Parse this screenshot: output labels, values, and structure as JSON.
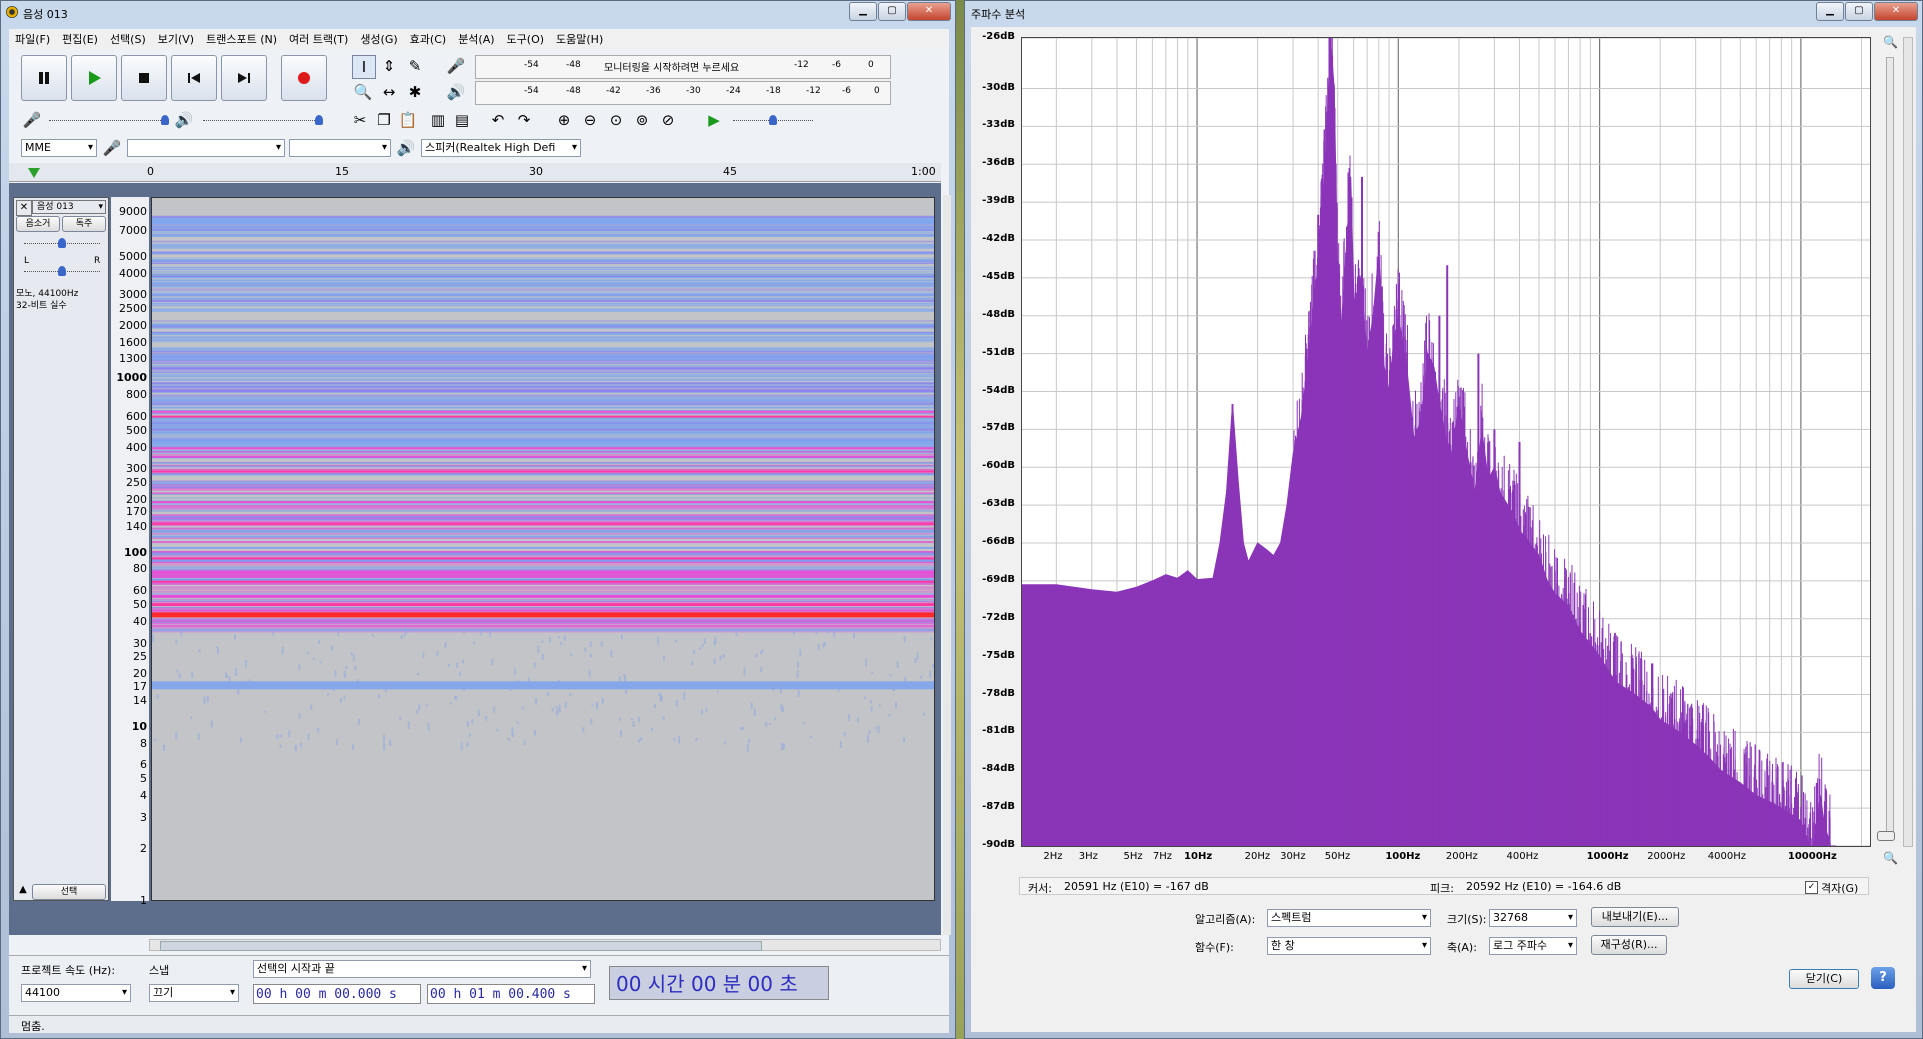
{
  "audacity": {
    "title": "음성 013",
    "menu": [
      "파일(F)",
      "편집(E)",
      "선택(S)",
      "보기(V)",
      "트랜스포트 (N)",
      "여러 트랙(T)",
      "생성(G)",
      "효과(C)",
      "분석(A)",
      "도구(O)",
      "도움말(H)"
    ],
    "meter_rec_labels": [
      "-54",
      "-48",
      "모니터링을 시작하려면 누르세요",
      "-12",
      "-6",
      "0"
    ],
    "meter_play_labels": [
      "-54",
      "-48",
      "-42",
      "-36",
      "-30",
      "-24",
      "-18",
      "-12",
      "-6",
      "0"
    ],
    "host": "MME",
    "output_device": "스피커(Realtek High Defi",
    "timeline_labels": [
      "0",
      "15",
      "30",
      "45",
      "1:00"
    ],
    "track": {
      "name": "음성 013",
      "mute": "음소거",
      "solo": "독주",
      "left": "L",
      "right": "R",
      "info1": "모노, 44100Hz",
      "info2": "32-비트 실수",
      "select": "선택"
    },
    "freq_axis": [
      "9000",
      "7000",
      "5000",
      "4000",
      "3000",
      "2500",
      "2000",
      "1600",
      "1300",
      "1000",
      "800",
      "600",
      "500",
      "400",
      "300",
      "250",
      "200",
      "170",
      "140",
      "100",
      "80",
      "60",
      "50",
      "40",
      "30",
      "25",
      "20",
      "17",
      "14",
      "10",
      "8",
      "6",
      "5",
      "4",
      "3",
      "2",
      "1"
    ],
    "bottom": {
      "rate_label": "프로젝트 속도 (Hz):",
      "rate_value": "44100",
      "snap_label": "스냅",
      "snap_value": "끄기",
      "selection_type": "선택의 시작과 끝",
      "sel_start": "00 h 00 m 00.000 s",
      "sel_end": "00 h 01 m 00.400 s",
      "big_time": "00 시간 00 분 00 초"
    },
    "status": "멈춤."
  },
  "freq_window": {
    "title": "주파수 분석",
    "db_labels": [
      "-26dB",
      "-30dB",
      "-33dB",
      "-36dB",
      "-39dB",
      "-42dB",
      "-45dB",
      "-48dB",
      "-51dB",
      "-54dB",
      "-57dB",
      "-60dB",
      "-63dB",
      "-66dB",
      "-69dB",
      "-72dB",
      "-75dB",
      "-78dB",
      "-81dB",
      "-84dB",
      "-87dB",
      "-90dB"
    ],
    "hz_labels": [
      {
        "t": "2Hz",
        "f": 2
      },
      {
        "t": "3Hz",
        "f": 3
      },
      {
        "t": "5Hz",
        "f": 5
      },
      {
        "t": "7Hz",
        "f": 7
      },
      {
        "t": "10Hz",
        "f": 10,
        "b": true
      },
      {
        "t": "20Hz",
        "f": 20
      },
      {
        "t": "30Hz",
        "f": 30
      },
      {
        "t": "50Hz",
        "f": 50
      },
      {
        "t": "100Hz",
        "f": 100,
        "b": true
      },
      {
        "t": "200Hz",
        "f": 200
      },
      {
        "t": "400Hz",
        "f": 400
      },
      {
        "t": "1000Hz",
        "f": 1000,
        "b": true
      },
      {
        "t": "2000Hz",
        "f": 2000
      },
      {
        "t": "4000Hz",
        "f": 4000
      },
      {
        "t": "10000Hz",
        "f": 10000,
        "b": true
      }
    ],
    "cursor_label": "커서:",
    "cursor_value": "20591 Hz (E10) = -167 dB",
    "peak_label": "피크:",
    "peak_value": "20592 Hz (E10) = -164.6 dB",
    "grid_label": "격자(G)",
    "algorithm_label": "알고리즘(A):",
    "algorithm_value": "스펙트럼",
    "size_label": "크기(S):",
    "size_value": "32768",
    "export_label": "내보내기(E)...",
    "function_label": "함수(F):",
    "function_value": "한 창",
    "axis_label": "축(A):",
    "axis_value": "로그 주파수",
    "replot_label": "재구성(R)...",
    "close_label": "닫기(C)",
    "help_label": "?"
  },
  "chart_data": {
    "type": "area",
    "xscale": "log",
    "xlim": [
      1.35,
      22050
    ],
    "ylim": [
      -90,
      -26
    ],
    "x": [
      1.35,
      2,
      3,
      4,
      5,
      6,
      7,
      8,
      9,
      10,
      12,
      13,
      14,
      15,
      16,
      17,
      18,
      20,
      22,
      24,
      26,
      28,
      30,
      33,
      36,
      38,
      40,
      42,
      44,
      46,
      48,
      50,
      52,
      55,
      58,
      60,
      62,
      65,
      70,
      75,
      80,
      85,
      90,
      95,
      100,
      110,
      120,
      130,
      140,
      150,
      160,
      170,
      180,
      200,
      220,
      240,
      260,
      280,
      300,
      320,
      350,
      380,
      400,
      450,
      500,
      550,
      600,
      700,
      800,
      900,
      1000,
      1200,
      1500,
      1800,
      2000,
      2500,
      3000,
      3500,
      4000,
      5000,
      6000,
      7000,
      8000,
      9000,
      10000,
      10500,
      11000,
      11500,
      12000,
      12500,
      13000,
      14000,
      15000
    ],
    "y": [
      -69.3,
      -69.3,
      -69.7,
      -69.9,
      -69.5,
      -69.0,
      -68.5,
      -68.8,
      -68.2,
      -68.9,
      -68.8,
      -66.0,
      -62.0,
      -55.0,
      -61.0,
      -66.0,
      -67.5,
      -66.0,
      -66.5,
      -67.0,
      -66.0,
      -63.0,
      -59.0,
      -56.0,
      -51.0,
      -47.0,
      -44.0,
      -39.0,
      -34.0,
      -26.0,
      -30.0,
      -45.0,
      -49.0,
      -43.0,
      -37.0,
      -46.0,
      -49.0,
      -45.0,
      -51.0,
      -48.0,
      -43.0,
      -52.0,
      -54.0,
      -50.0,
      -48.0,
      -52.0,
      -58.0,
      -56.0,
      -51.0,
      -52.0,
      -55.0,
      -57.0,
      -60.0,
      -55.0,
      -59.0,
      -62.0,
      -57.0,
      -61.0,
      -60.0,
      -62.0,
      -63.0,
      -64.0,
      -65.0,
      -66.0,
      -67.0,
      -69.0,
      -70.0,
      -71.0,
      -73.0,
      -74.0,
      -75.0,
      -77.0,
      -78.0,
      -79.0,
      -80.0,
      -81.0,
      -82.0,
      -83.0,
      -84.0,
      -85.0,
      -86.0,
      -86.5,
      -87.0,
      -87.5,
      -88.0,
      -89.0,
      -90.0,
      -90.0,
      -88.0,
      -86.0,
      -88.0,
      -90.0,
      -90.0
    ],
    "peaks": [
      {
        "f": 46,
        "db": -26
      },
      {
        "f": 40,
        "db": -40
      },
      {
        "f": 66,
        "db": -37
      },
      {
        "f": 55,
        "db": -43
      },
      {
        "f": 15,
        "db": -55
      },
      {
        "f": 160,
        "db": -48
      },
      {
        "f": 175,
        "db": -44
      },
      {
        "f": 250,
        "db": -51
      },
      {
        "f": 100,
        "db": -48
      },
      {
        "f": 130,
        "db": -55
      },
      {
        "f": 300,
        "db": -57
      },
      {
        "f": 400,
        "db": -58
      },
      {
        "f": 12000,
        "db": -85
      }
    ],
    "color": "#8a34b8",
    "grid": true,
    "xlabel": "",
    "ylabel": ""
  }
}
